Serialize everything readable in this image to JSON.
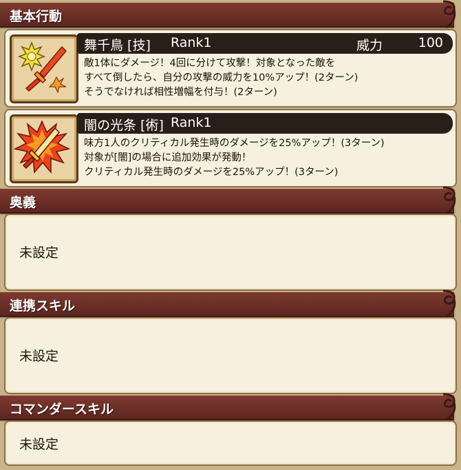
{
  "basic_action": {
    "header": "基本行動",
    "skills": [
      {
        "name": "舞千鳥 [技]",
        "rank": "Rank1",
        "power_label": "威力",
        "power_value": "100",
        "icon": "sword-burst-icon",
        "description": [
          "敵1体にダメージ！4回に分けて攻撃！対象となった敵を",
          "すべて倒したら、自分の攻撃の威力を10%アップ！(2ターン)",
          "そうでなければ相性増幅を付与！(2ターン)"
        ]
      },
      {
        "name": "闇の光条 [術]",
        "rank": "Rank1",
        "icon": "flaming-sword-icon",
        "description": [
          "味方1人のクリティカル発生時のダメージを25%アップ！(3ターン)",
          "対象が[闇]の場合に追加効果が発動！",
          "クリティカル発生時のダメージを25%アップ！(3ターン)"
        ]
      }
    ]
  },
  "ougi": {
    "header": "奥義",
    "value": "未設定"
  },
  "link_skill": {
    "header": "連携スキル",
    "value": "未設定"
  },
  "commander_skill": {
    "header": "コマンダースキル",
    "value": "未設定"
  },
  "colors": {
    "background": "#c9b389",
    "header": "#6e3029",
    "panel": "#f6f0df",
    "skill_bar": "#2a1e18"
  }
}
